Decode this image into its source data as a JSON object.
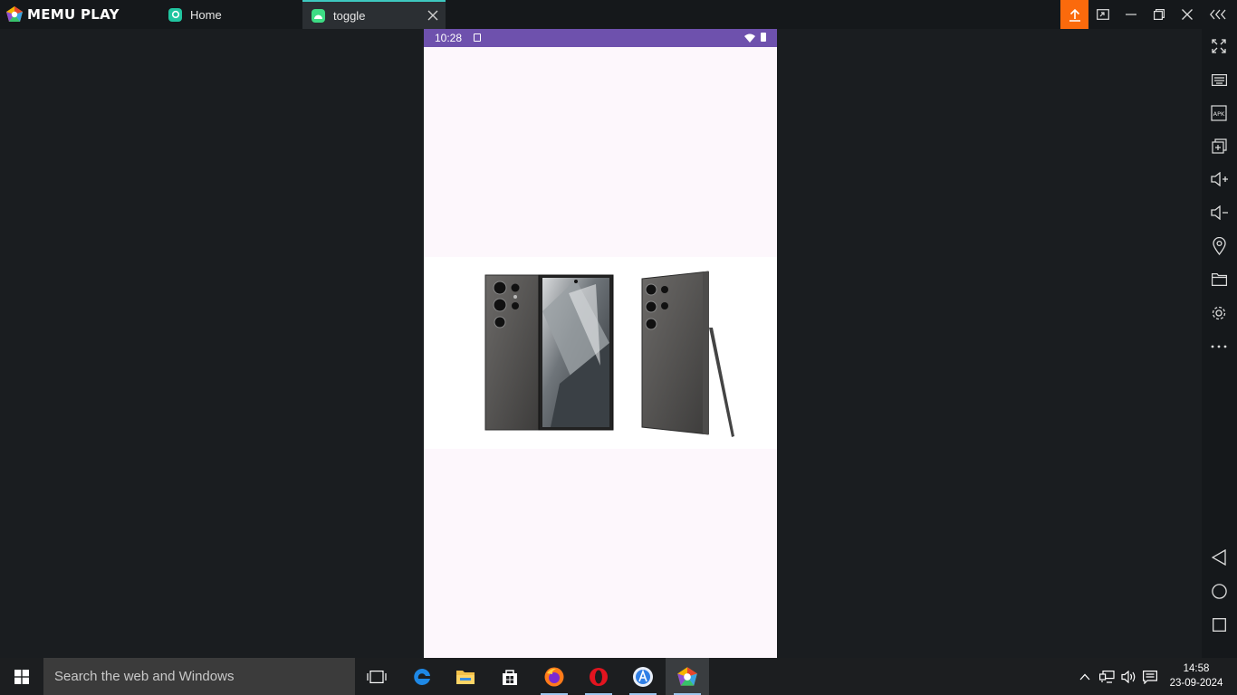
{
  "titlebar": {
    "app_name": "MEMU PLAY",
    "tabs": [
      {
        "label": "Home",
        "icon": "memu-home-icon",
        "active": false
      },
      {
        "label": "toggle",
        "icon": "android-icon",
        "active": true
      }
    ],
    "accent": "#fb6a0c",
    "active_tab_accent": "#3ec8c0"
  },
  "sidebar": {
    "tools": [
      "fullscreen-icon",
      "keyboard-icon",
      "apk-icon",
      "multi-instance-icon",
      "volume-up-icon",
      "volume-down-icon",
      "location-icon",
      "folder-icon",
      "settings-icon",
      "more-icon"
    ],
    "apk_label": "APK",
    "nav": [
      "back-icon",
      "home-circle-icon",
      "recents-square-icon"
    ]
  },
  "phone": {
    "status_time": "10:28",
    "status_bar_color": "#6e51ad",
    "background": "#fdf7fc",
    "image": "samsung-galaxy-s24-ultra-product-image"
  },
  "taskbar": {
    "search_placeholder": "Search the web and Windows",
    "apps": [
      "task-view-icon",
      "edge-icon",
      "file-explorer-icon",
      "store-icon",
      "firefox-icon",
      "opera-icon",
      "app-store-icon",
      "memu-icon"
    ],
    "time": "14:58",
    "date": "23-09-2024"
  }
}
